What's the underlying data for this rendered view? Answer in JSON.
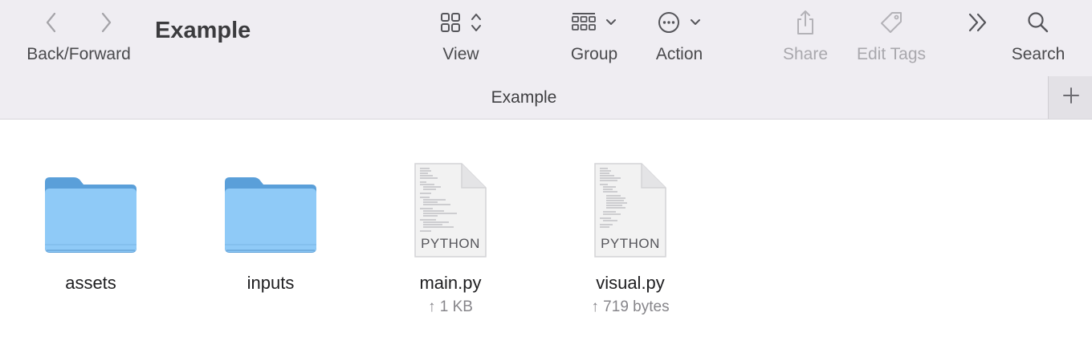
{
  "toolbar": {
    "title": "Example",
    "back_forward_label": "Back/Forward",
    "view_label": "View",
    "group_label": "Group",
    "action_label": "Action",
    "share_label": "Share",
    "edit_tags_label": "Edit Tags",
    "search_label": "Search",
    "icons": [
      "chevron-left-icon",
      "chevron-right-icon",
      "grid-view-icon",
      "up-down-chevron-icon",
      "group-icon",
      "chevron-down-icon",
      "ellipsis-circle-icon",
      "share-icon",
      "tag-icon",
      "more-chevrons-icon",
      "search-icon",
      "plus-icon"
    ]
  },
  "pathbar": {
    "label": "Example"
  },
  "colors": {
    "toolbar_bg": "#efedf2",
    "folder_blue": "#8fcaf7",
    "disabled_text": "#a9a8ad"
  },
  "files": [
    {
      "name": "assets",
      "kind": "folder",
      "meta": ""
    },
    {
      "name": "inputs",
      "kind": "folder",
      "meta": ""
    },
    {
      "name": "main.py",
      "kind": "python",
      "ext_label": "PYTHON",
      "meta": "↑ 1 KB"
    },
    {
      "name": "visual.py",
      "kind": "python",
      "ext_label": "PYTHON",
      "meta": "↑ 719 bytes"
    }
  ]
}
